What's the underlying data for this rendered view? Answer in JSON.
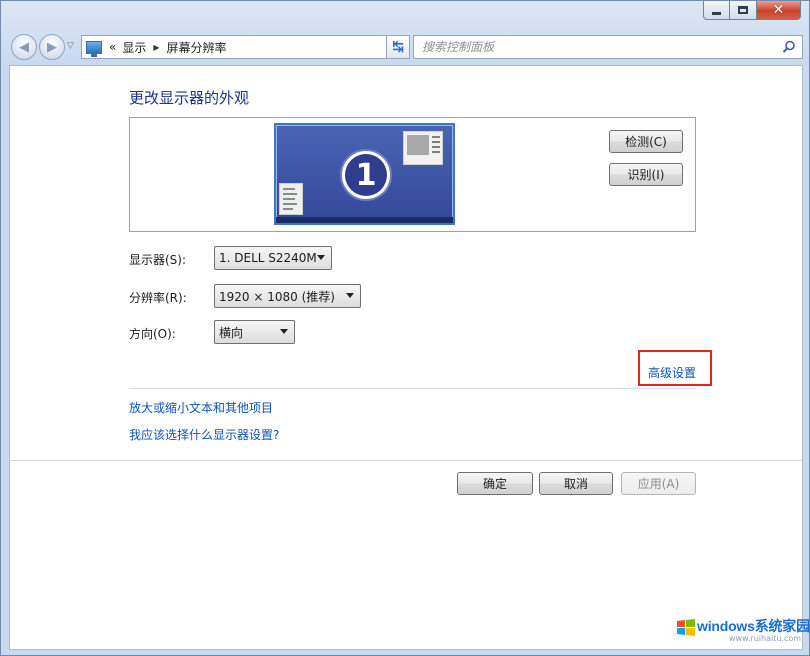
{
  "window": {
    "caption_buttons": [
      "minimize",
      "maximize",
      "close"
    ]
  },
  "toolbar": {
    "address": {
      "overflow": "«",
      "crumbs": [
        "显示",
        "屏幕分辨率"
      ]
    },
    "search": {
      "placeholder": "搜索控制面板"
    }
  },
  "main": {
    "title": "更改显示器的外观",
    "monitor_number": "1",
    "detect_button": "检测(C)",
    "identify_button": "识别(I)",
    "display": {
      "label": "显示器(S):",
      "value": "1. DELL S2240M"
    },
    "resolution": {
      "label": "分辨率(R):",
      "value": "1920 × 1080 (推荐)"
    },
    "orientation": {
      "label": "方向(O):",
      "value": "横向"
    },
    "advanced_link": "高级设置",
    "links": [
      "放大或缩小文本和其他项目",
      "我应该选择什么显示器设置?"
    ],
    "ok_button": "确定",
    "cancel_button": "取消",
    "apply_button": "应用(A)"
  },
  "watermark": {
    "text": "windows系统家园",
    "sub": "www.ruihaitu.com"
  },
  "colors": {
    "link": "#0d54b8",
    "title": "#1e3287",
    "highlight_box": "#e0261c",
    "monitor_bg": "#4a64b4"
  }
}
